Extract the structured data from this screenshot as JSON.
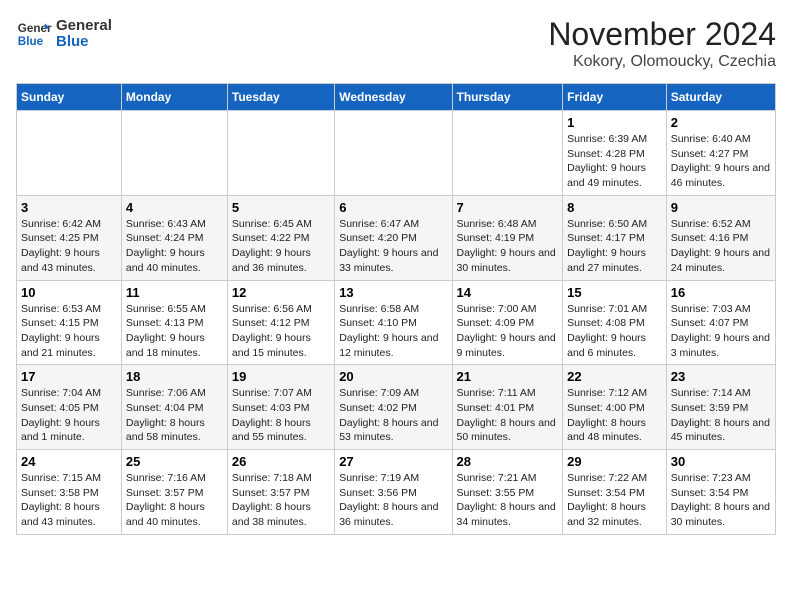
{
  "logo": {
    "line1": "General",
    "line2": "Blue"
  },
  "title": "November 2024",
  "location": "Kokory, Olomoucky, Czechia",
  "days_of_week": [
    "Sunday",
    "Monday",
    "Tuesday",
    "Wednesday",
    "Thursday",
    "Friday",
    "Saturday"
  ],
  "weeks": [
    [
      {
        "day": "",
        "info": ""
      },
      {
        "day": "",
        "info": ""
      },
      {
        "day": "",
        "info": ""
      },
      {
        "day": "",
        "info": ""
      },
      {
        "day": "",
        "info": ""
      },
      {
        "day": "1",
        "info": "Sunrise: 6:39 AM\nSunset: 4:28 PM\nDaylight: 9 hours and 49 minutes."
      },
      {
        "day": "2",
        "info": "Sunrise: 6:40 AM\nSunset: 4:27 PM\nDaylight: 9 hours and 46 minutes."
      }
    ],
    [
      {
        "day": "3",
        "info": "Sunrise: 6:42 AM\nSunset: 4:25 PM\nDaylight: 9 hours and 43 minutes."
      },
      {
        "day": "4",
        "info": "Sunrise: 6:43 AM\nSunset: 4:24 PM\nDaylight: 9 hours and 40 minutes."
      },
      {
        "day": "5",
        "info": "Sunrise: 6:45 AM\nSunset: 4:22 PM\nDaylight: 9 hours and 36 minutes."
      },
      {
        "day": "6",
        "info": "Sunrise: 6:47 AM\nSunset: 4:20 PM\nDaylight: 9 hours and 33 minutes."
      },
      {
        "day": "7",
        "info": "Sunrise: 6:48 AM\nSunset: 4:19 PM\nDaylight: 9 hours and 30 minutes."
      },
      {
        "day": "8",
        "info": "Sunrise: 6:50 AM\nSunset: 4:17 PM\nDaylight: 9 hours and 27 minutes."
      },
      {
        "day": "9",
        "info": "Sunrise: 6:52 AM\nSunset: 4:16 PM\nDaylight: 9 hours and 24 minutes."
      }
    ],
    [
      {
        "day": "10",
        "info": "Sunrise: 6:53 AM\nSunset: 4:15 PM\nDaylight: 9 hours and 21 minutes."
      },
      {
        "day": "11",
        "info": "Sunrise: 6:55 AM\nSunset: 4:13 PM\nDaylight: 9 hours and 18 minutes."
      },
      {
        "day": "12",
        "info": "Sunrise: 6:56 AM\nSunset: 4:12 PM\nDaylight: 9 hours and 15 minutes."
      },
      {
        "day": "13",
        "info": "Sunrise: 6:58 AM\nSunset: 4:10 PM\nDaylight: 9 hours and 12 minutes."
      },
      {
        "day": "14",
        "info": "Sunrise: 7:00 AM\nSunset: 4:09 PM\nDaylight: 9 hours and 9 minutes."
      },
      {
        "day": "15",
        "info": "Sunrise: 7:01 AM\nSunset: 4:08 PM\nDaylight: 9 hours and 6 minutes."
      },
      {
        "day": "16",
        "info": "Sunrise: 7:03 AM\nSunset: 4:07 PM\nDaylight: 9 hours and 3 minutes."
      }
    ],
    [
      {
        "day": "17",
        "info": "Sunrise: 7:04 AM\nSunset: 4:05 PM\nDaylight: 9 hours and 1 minute."
      },
      {
        "day": "18",
        "info": "Sunrise: 7:06 AM\nSunset: 4:04 PM\nDaylight: 8 hours and 58 minutes."
      },
      {
        "day": "19",
        "info": "Sunrise: 7:07 AM\nSunset: 4:03 PM\nDaylight: 8 hours and 55 minutes."
      },
      {
        "day": "20",
        "info": "Sunrise: 7:09 AM\nSunset: 4:02 PM\nDaylight: 8 hours and 53 minutes."
      },
      {
        "day": "21",
        "info": "Sunrise: 7:11 AM\nSunset: 4:01 PM\nDaylight: 8 hours and 50 minutes."
      },
      {
        "day": "22",
        "info": "Sunrise: 7:12 AM\nSunset: 4:00 PM\nDaylight: 8 hours and 48 minutes."
      },
      {
        "day": "23",
        "info": "Sunrise: 7:14 AM\nSunset: 3:59 PM\nDaylight: 8 hours and 45 minutes."
      }
    ],
    [
      {
        "day": "24",
        "info": "Sunrise: 7:15 AM\nSunset: 3:58 PM\nDaylight: 8 hours and 43 minutes."
      },
      {
        "day": "25",
        "info": "Sunrise: 7:16 AM\nSunset: 3:57 PM\nDaylight: 8 hours and 40 minutes."
      },
      {
        "day": "26",
        "info": "Sunrise: 7:18 AM\nSunset: 3:57 PM\nDaylight: 8 hours and 38 minutes."
      },
      {
        "day": "27",
        "info": "Sunrise: 7:19 AM\nSunset: 3:56 PM\nDaylight: 8 hours and 36 minutes."
      },
      {
        "day": "28",
        "info": "Sunrise: 7:21 AM\nSunset: 3:55 PM\nDaylight: 8 hours and 34 minutes."
      },
      {
        "day": "29",
        "info": "Sunrise: 7:22 AM\nSunset: 3:54 PM\nDaylight: 8 hours and 32 minutes."
      },
      {
        "day": "30",
        "info": "Sunrise: 7:23 AM\nSunset: 3:54 PM\nDaylight: 8 hours and 30 minutes."
      }
    ]
  ]
}
